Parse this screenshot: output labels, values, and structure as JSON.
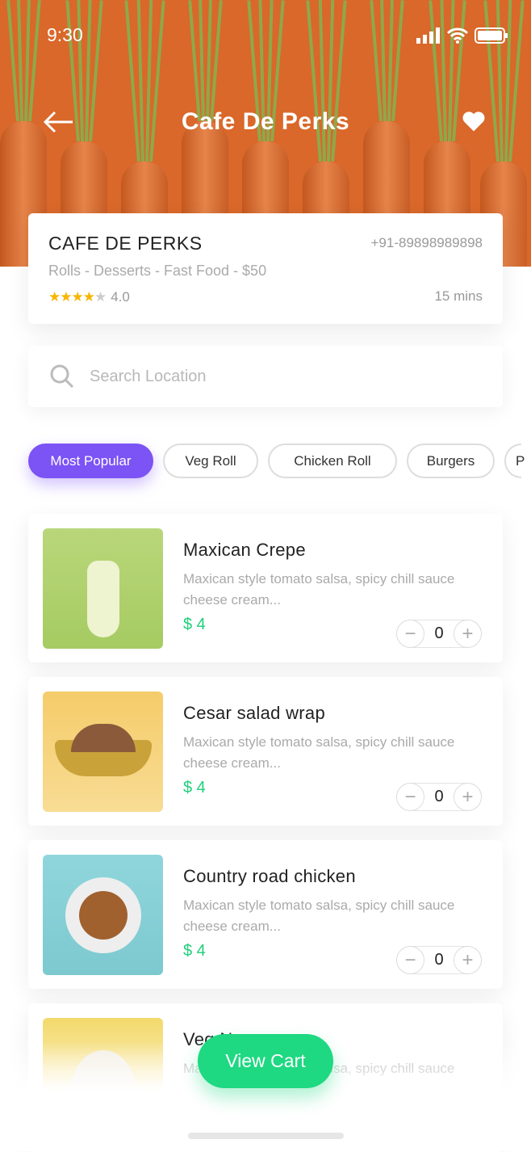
{
  "status": {
    "time": "9:30"
  },
  "header": {
    "title": "Cafe De Perks"
  },
  "restaurant": {
    "name": "CAFE DE PERKS",
    "phone": "+91-89898989898",
    "categories": "Rolls - Desserts - Fast Food  - $50",
    "stars": "★★★★",
    "star_empty": "★",
    "rating": "4.0",
    "delivery_time": "15 mins"
  },
  "search": {
    "placeholder": "Search Location"
  },
  "filters": [
    {
      "label": "Most Popular",
      "active": true
    },
    {
      "label": "Veg Roll"
    },
    {
      "label": "Chicken Roll"
    },
    {
      "label": "Burgers"
    },
    {
      "label": "P"
    }
  ],
  "items": [
    {
      "name": "Maxican Crepe",
      "desc": "Maxican style tomato salsa, spicy chill sauce cheese cream...",
      "price": "$ 4",
      "qty": "0"
    },
    {
      "name": "Cesar salad wrap",
      "desc": "Maxican style tomato salsa, spicy chill sauce cheese cream...",
      "price": "$ 4",
      "qty": "0"
    },
    {
      "name": "Country road chicken",
      "desc": "Maxican style tomato salsa, spicy chill sauce cheese cream...",
      "price": "$ 4",
      "qty": "0"
    },
    {
      "name": "Veg N",
      "desc": "Maxican style tomato salsa, spicy chill sauce",
      "price": "",
      "qty": ""
    }
  ],
  "stepper": {
    "minus": "−",
    "plus": "+"
  },
  "cart": {
    "label": "View Cart"
  },
  "colors": {
    "accent": "#7c53f5",
    "green": "#1ed882",
    "star": "#f7b500",
    "hero": "#d9682a"
  }
}
